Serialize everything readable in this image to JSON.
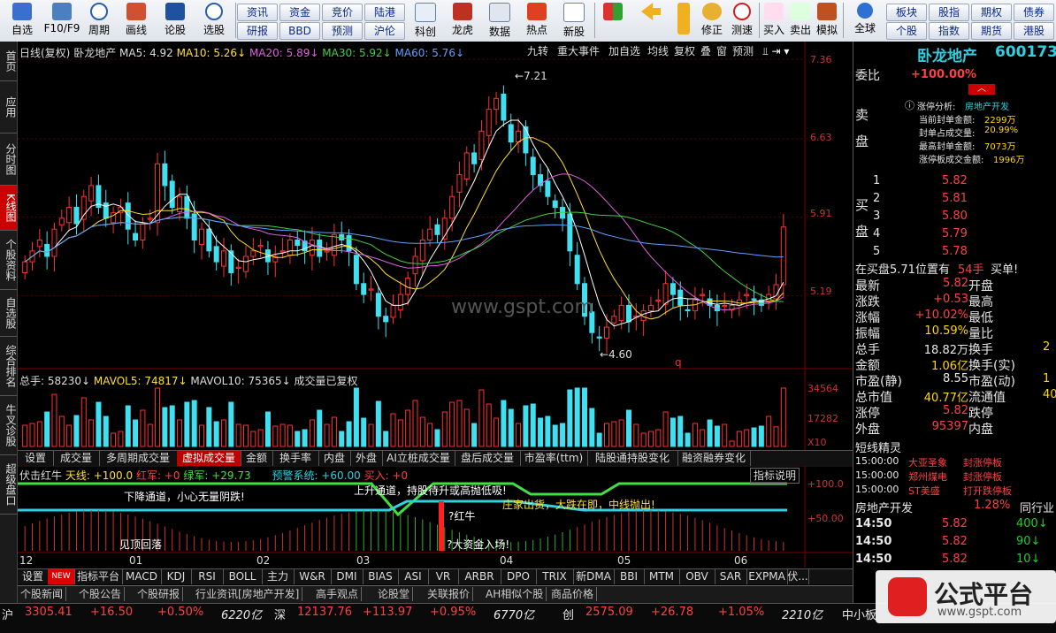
{
  "toolbar": {
    "items": [
      "自选",
      "F10/F9",
      "周期",
      "画线",
      "论股",
      "选股",
      "资讯",
      "研报",
      "资金",
      "BBD",
      "竞价",
      "预测",
      "陆港",
      "沪伦",
      "科创",
      "龙虎",
      "数据",
      "热点",
      "新股",
      "修正",
      "测速",
      "买入",
      "卖出",
      "模拟",
      "全球",
      "板块",
      "个股",
      "股指",
      "指数",
      "期权",
      "期货",
      "债券",
      "港股"
    ]
  },
  "sidebar": [
    "首页",
    "应用",
    "分时图",
    "K线图",
    "个股资料",
    "自选股",
    "综合排名",
    "牛叉诊股",
    "超级盘口"
  ],
  "chart_header": {
    "legend": [
      "日线(复权)",
      "卧龙地产",
      "MA5: 4.92",
      "MA10: 5.26↓",
      "MA20: 5.89↓",
      "MA30: 5.92↓",
      "MA60: 5.76↓"
    ],
    "buttons": [
      "九转",
      "重大事件",
      "加自选",
      "均线",
      "复权",
      "叠",
      "窗",
      "预测"
    ]
  },
  "price_axis": [
    "7.36",
    "6.63",
    "5.91",
    "5.19"
  ],
  "annot": {
    "high": "7.21",
    "low": "4.60",
    "q": "q",
    "watermark": "www.gspt.com"
  },
  "volume_header": [
    "总手: 58230↓",
    "MAVOL5: 74817↓",
    "MAVOL10: 75365↓",
    "成交量已复权"
  ],
  "volume_axis": [
    "34564",
    "17282",
    "X10"
  ],
  "tabs1": [
    "设置",
    "成交量",
    "多周期成交量",
    "虚拟成交量",
    "金额",
    "换手率",
    "内盘",
    "外盘",
    "AI立桩成交量",
    "盘后成交量",
    "市盈率(ttm)",
    "陆股通持股变化",
    "融资融券变化"
  ],
  "indicator": {
    "legend": [
      "伏击红牛",
      "天线: +100.0",
      "红军: +0",
      "绿军: +29.73",
      "预警系统: +60.00",
      "买入: +0"
    ],
    "btn": "指标说明",
    "axis": [
      "+100.0",
      "+50.00"
    ],
    "texts": [
      "下降通道，小心无量阴跌!",
      "上升通道，持股待升或高抛低吸!",
      "庄家出货，大跌在即，中线抛出!",
      "见顶回落",
      "红牛",
      "大资金入场!"
    ]
  },
  "months": [
    "12",
    "01",
    "02",
    "03",
    "04",
    "05",
    "06"
  ],
  "tabs2": [
    "设置",
    "NEW",
    "指标平台",
    "MACD",
    "KDJ",
    "RSI",
    "BOLL",
    "主力",
    "W&R",
    "DMI",
    "BIAS",
    "ASI",
    "VR",
    "ARBR",
    "DPO",
    "TRIX",
    "新DMA",
    "BBI",
    "MTM",
    "OBV",
    "SAR",
    "EXPMA",
    "伏..."
  ],
  "news": [
    "个股新闻",
    "个股公告",
    "个股研报",
    "行业资讯[房地产开发]",
    "高手观点",
    "论股堂",
    "关联报价",
    "AH相似个股",
    "商品价格"
  ],
  "right": {
    "name": "卧龙地产",
    "code": "600173",
    "weibi_label": "委比",
    "weibi": "+100.00%",
    "analysis": [
      "涨停分析:",
      "房地产开发",
      "当前封单金额:",
      "2299万",
      "封单占成交量:",
      "20.99%",
      "最高封单金额:",
      "7073万",
      "涨停板成交金额:",
      "1996万"
    ],
    "sell_label": "卖盘",
    "buy_label": "买盘",
    "buy": [
      [
        "1",
        "5.82"
      ],
      [
        "2",
        "5.81"
      ],
      [
        "3",
        "5.80"
      ],
      [
        "4",
        "5.79"
      ],
      [
        "5",
        "5.78"
      ]
    ],
    "inbuy": "在买盘5.71位置有",
    "inbuy_vol": "54手",
    "inbuy_btn": "买单!",
    "stats": [
      [
        "最新",
        "5.82",
        "开盘",
        ""
      ],
      [
        "涨跌",
        "+0.53",
        "最高",
        ""
      ],
      [
        "涨幅",
        "+10.02%",
        "最低",
        ""
      ],
      [
        "振幅",
        "10.59%",
        "量比",
        ""
      ],
      [
        "总手",
        "18.82万",
        "换手",
        "2"
      ],
      [
        "金额",
        "1.06亿",
        "换手(实)",
        ""
      ],
      [
        "市盈(静)",
        "8.55",
        "市盈(动)",
        "1"
      ],
      [
        "总市值",
        "40.77亿",
        "流通值",
        "40."
      ],
      [
        "涨停",
        "5.82",
        "跌停",
        ""
      ],
      [
        "外盘",
        "95397",
        "内盘",
        ""
      ]
    ],
    "short_title": "短线精灵",
    "short": [
      [
        "15:00:00",
        "大亚圣象",
        "封涨停板"
      ],
      [
        "15:00:00",
        "郑州煤电",
        "封涨停板"
      ],
      [
        "15:00:00",
        "ST美盛",
        "打开跌停板"
      ]
    ],
    "industry": "房地产开发",
    "industry_pct": "1.28%",
    "industry_btn": "同行业",
    "ticks": [
      [
        "14:50",
        "5.82",
        "400"
      ],
      [
        "14:50",
        "5.82",
        "90"
      ],
      [
        "14:50",
        "5.82",
        "10"
      ]
    ]
  },
  "status": [
    [
      "沪",
      "3305.41",
      "+16.50",
      "+0.50%",
      "6220亿"
    ],
    [
      "深",
      "12137.76",
      "+113.97",
      "+0.95%",
      "6770亿"
    ],
    [
      "创",
      "2575.09",
      "+26.78",
      "+1.05%",
      "2210亿"
    ]
  ],
  "status_extra": "中小板",
  "logo": {
    "text": "公式平台",
    "url": "www.gspt.com"
  },
  "chart_data": {
    "type": "candlestick",
    "title": "卧龙地产 600173 日线(复权)",
    "ylim": [
      4.6,
      7.36
    ],
    "yticks": [
      7.36,
      6.63,
      5.91,
      5.19
    ],
    "high": 7.21,
    "low": 4.6,
    "close": [
      5.5,
      5.6,
      5.7,
      5.55,
      5.8,
      5.9,
      6.0,
      5.85,
      6.1,
      6.2,
      6.0,
      5.9,
      5.95,
      6.0,
      5.8,
      5.7,
      5.85,
      5.9,
      6.4,
      6.2,
      6.0,
      6.1,
      5.9,
      5.7,
      5.8,
      5.6,
      5.5,
      5.6,
      5.4,
      5.45,
      5.55,
      5.6,
      5.65,
      5.5,
      5.55,
      5.6,
      5.7,
      5.65,
      5.6,
      5.7,
      5.55,
      5.6,
      5.75,
      5.7,
      5.6,
      5.3,
      5.2,
      5.25,
      5.0,
      4.95,
      5.1,
      5.2,
      5.35,
      5.55,
      5.7,
      5.8,
      5.75,
      5.9,
      6.1,
      6.3,
      6.5,
      6.4,
      6.7,
      6.9,
      7.0,
      6.8,
      6.6,
      6.7,
      6.5,
      6.3,
      6.2,
      6.1,
      6.0,
      5.9,
      5.6,
      5.3,
      5.0,
      4.85,
      4.8,
      4.9,
      5.0,
      5.1,
      4.95,
      5.0,
      5.05,
      5.1,
      5.15,
      5.3,
      5.2,
      5.1,
      5.05,
      5.15,
      5.2,
      5.1,
      5.05,
      5.1,
      5.1,
      5.15,
      5.2,
      5.15,
      5.1,
      5.2,
      5.29,
      5.82
    ]
  }
}
